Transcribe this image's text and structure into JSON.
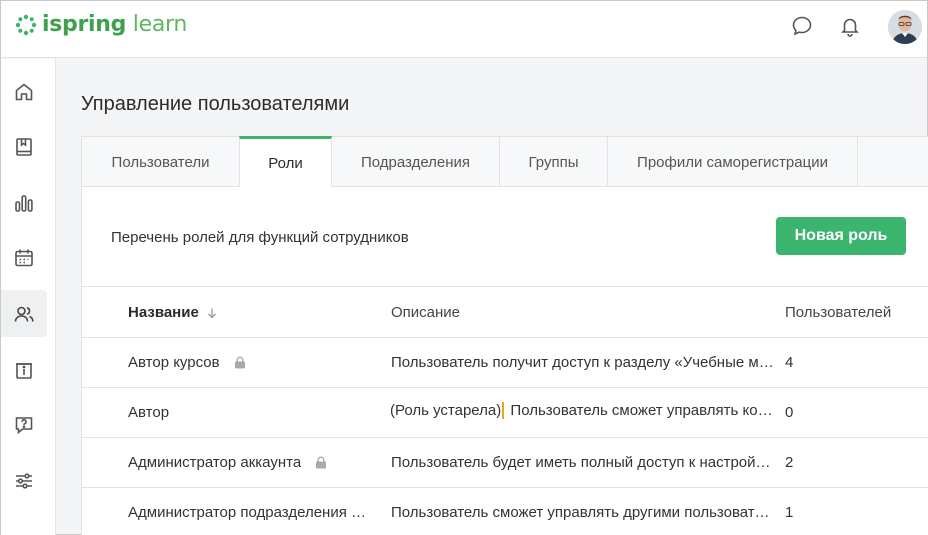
{
  "header": {
    "logo_bold": "ispring",
    "logo_light": "learn",
    "icons": [
      "chat-icon",
      "bell-icon",
      "user-avatar"
    ]
  },
  "sidebar": {
    "items": [
      {
        "icon": "home-icon"
      },
      {
        "icon": "book-icon"
      },
      {
        "icon": "bar-chart-icon"
      },
      {
        "icon": "calendar-icon"
      },
      {
        "icon": "users-icon",
        "active": true
      },
      {
        "icon": "info-card-icon"
      },
      {
        "icon": "help-icon"
      },
      {
        "icon": "sliders-icon"
      }
    ]
  },
  "page": {
    "title": "Управление пользователями",
    "tabs": [
      {
        "label": "Пользователи"
      },
      {
        "label": "Роли",
        "active": true
      },
      {
        "label": "Подразделения"
      },
      {
        "label": "Группы"
      },
      {
        "label": "Профили саморегистрации"
      }
    ],
    "description": "Перечень ролей для функций сотрудников",
    "new_role_label": "Новая роль"
  },
  "table": {
    "headers": {
      "name": "Название",
      "description": "Описание",
      "users": "Пользователей"
    },
    "rows": [
      {
        "name": "Автор курсов",
        "locked": true,
        "description": "Пользователь получит доступ к разделу «Учебные материалы»",
        "users": "4"
      },
      {
        "name": "Автор",
        "locked": false,
        "outdated_tag": "(Роль устарела)",
        "description": " Пользователь сможет управлять контентом",
        "users": "0"
      },
      {
        "name": "Администратор аккаунта",
        "locked": true,
        "description": "Пользователь будет иметь полный доступ к настройкам",
        "users": "2"
      },
      {
        "name": "Администратор подразделения пользователей",
        "locked": false,
        "description": "Пользователь сможет управлять другими пользователями",
        "users": "1"
      }
    ]
  },
  "colors": {
    "accent": "#3bb46e",
    "highlight": "#e6a817"
  }
}
